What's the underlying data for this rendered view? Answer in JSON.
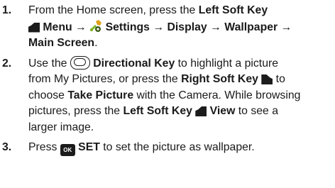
{
  "steps": [
    {
      "number": "1.",
      "t1": "From the Home screen, press the ",
      "b1": "Left Soft Key",
      "b2": "Menu → ",
      "b3": "Settings → Display → Wallpaper →",
      "b4": "Main Screen",
      "t2": "."
    },
    {
      "number": "2.",
      "t1": "Use the ",
      "b1": "Directional Key",
      "t2": " to highlight a picture",
      "t3": "from My Pictures, or press the ",
      "b2": "Right Soft Key",
      "t4": " to",
      "t5": "choose ",
      "b3": "Take Picture",
      "t6": " with the Camera. While browsing",
      "t7": "pictures, press the ",
      "b4": "Left Soft Key",
      "b5": "View",
      "t8": " to see a",
      "t9": "larger image."
    },
    {
      "number": "3.",
      "t1": "Press ",
      "key_label": "OK",
      "b1": "SET",
      "t2": " to set the picture as wallpaper."
    }
  ],
  "icons": {
    "left_soft_key": "left-soft-key-icon",
    "right_soft_key": "right-soft-key-icon",
    "settings": "settings-icon",
    "directional_key": "directional-key-icon",
    "ok_key": "ok-key-icon"
  }
}
